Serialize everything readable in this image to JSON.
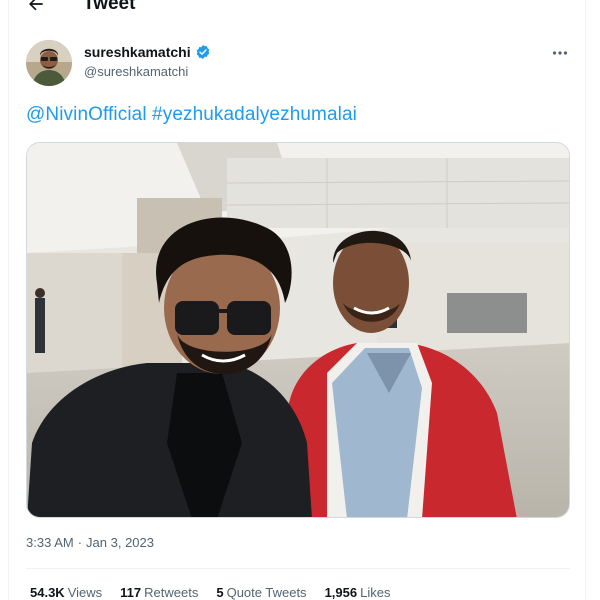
{
  "header": {
    "title": "Tweet",
    "back_icon": "arrow-left-icon"
  },
  "author": {
    "display_name": "sureshkamatchi",
    "handle": "@sureshkamatchi",
    "verified": true,
    "verified_color": "#1d9bf0"
  },
  "tweet": {
    "mention": "@NivinOfficial",
    "hashtag": "#yezhukadalyezhumalai",
    "link_color": "#1d9bf0"
  },
  "meta": {
    "time": "3:33 AM",
    "separator": "·",
    "date": "Jan 3, 2023"
  },
  "stats": [
    {
      "count": "54.3K",
      "label": "Views"
    },
    {
      "count": "117",
      "label": "Retweets"
    },
    {
      "count": "5",
      "label": "Quote Tweets"
    },
    {
      "count": "1,956",
      "label": "Likes"
    }
  ],
  "icons": {
    "more": "more-options-icon",
    "verified": "verified-badge-icon"
  }
}
